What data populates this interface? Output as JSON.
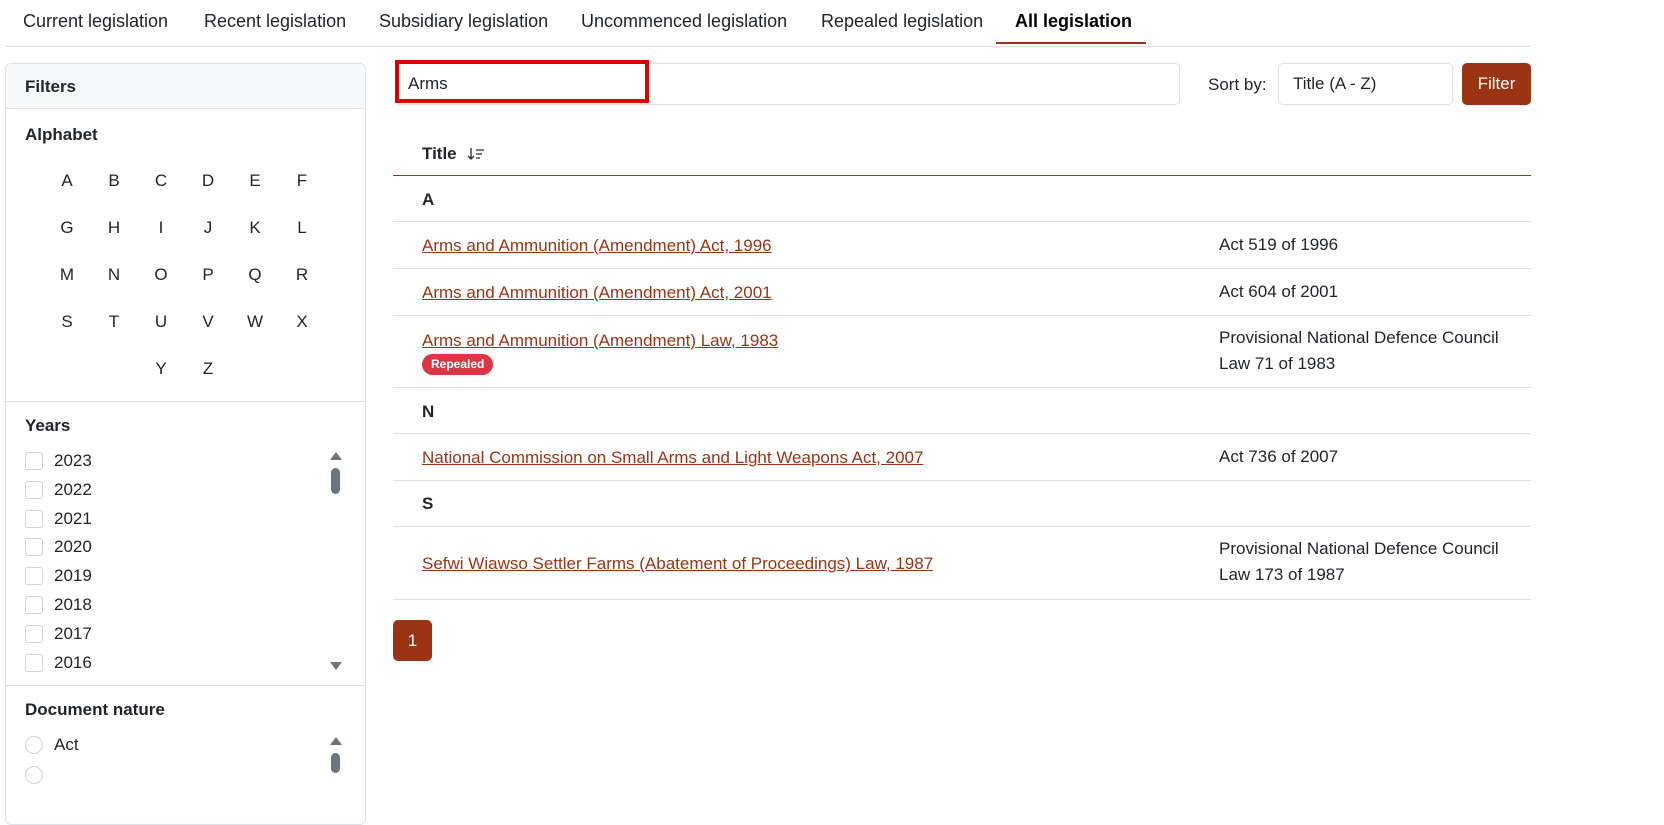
{
  "tabs": [
    {
      "label": "Current legislation"
    },
    {
      "label": "Recent legislation"
    },
    {
      "label": "Subsidiary legislation"
    },
    {
      "label": "Uncommenced legislation"
    },
    {
      "label": "Repealed legislation"
    },
    {
      "label": "All legislation",
      "active": true
    }
  ],
  "sidebar": {
    "header": "Filters",
    "alphabet_title": "Alphabet",
    "letters": [
      "A",
      "B",
      "C",
      "D",
      "E",
      "F",
      "G",
      "H",
      "I",
      "J",
      "K",
      "L",
      "M",
      "N",
      "O",
      "P",
      "Q",
      "R",
      "S",
      "T",
      "U",
      "V",
      "W",
      "X",
      "Y",
      "Z"
    ],
    "years_title": "Years",
    "years": [
      "2023",
      "2022",
      "2021",
      "2020",
      "2019",
      "2018",
      "2017",
      "2016"
    ],
    "doc_nature_title": "Document nature",
    "doc_nature_items": [
      "Act"
    ]
  },
  "search": {
    "value": "Arms"
  },
  "sort": {
    "label": "Sort by:",
    "value": "Title (A - Z)"
  },
  "filter_button": "Filter",
  "table": {
    "header_title": "Title",
    "groups": [
      {
        "letter": "A"
      },
      {
        "letter": "N"
      },
      {
        "letter": "S"
      }
    ],
    "rows": [
      {
        "title": "Arms and Ammunition (Amendment) Act, 1996",
        "number": "Act 519 of 1996"
      },
      {
        "title": "Arms and Ammunition (Amendment) Act, 2001",
        "number": "Act 604 of 2001"
      },
      {
        "title": "Arms and Ammunition (Amendment) Law, 1983",
        "number_line1": "Provisional National Defence Council",
        "number_line2": "Law 71 of 1983",
        "badge": "Repealed"
      },
      {
        "title": "National Commission on Small Arms and Light Weapons Act, 2007",
        "number": "Act 736 of 2007"
      },
      {
        "title": "Sefwi Wiawso Settler Farms (Abatement of Proceedings) Law, 1987",
        "number_line1": "Provisional National Defence Council",
        "number_line2": "Law 173 of 1987"
      }
    ]
  },
  "pagination": {
    "current": "1"
  },
  "colors": {
    "accent": "#9a3412",
    "badge": "#dc3545",
    "highlight": "#e00000"
  }
}
